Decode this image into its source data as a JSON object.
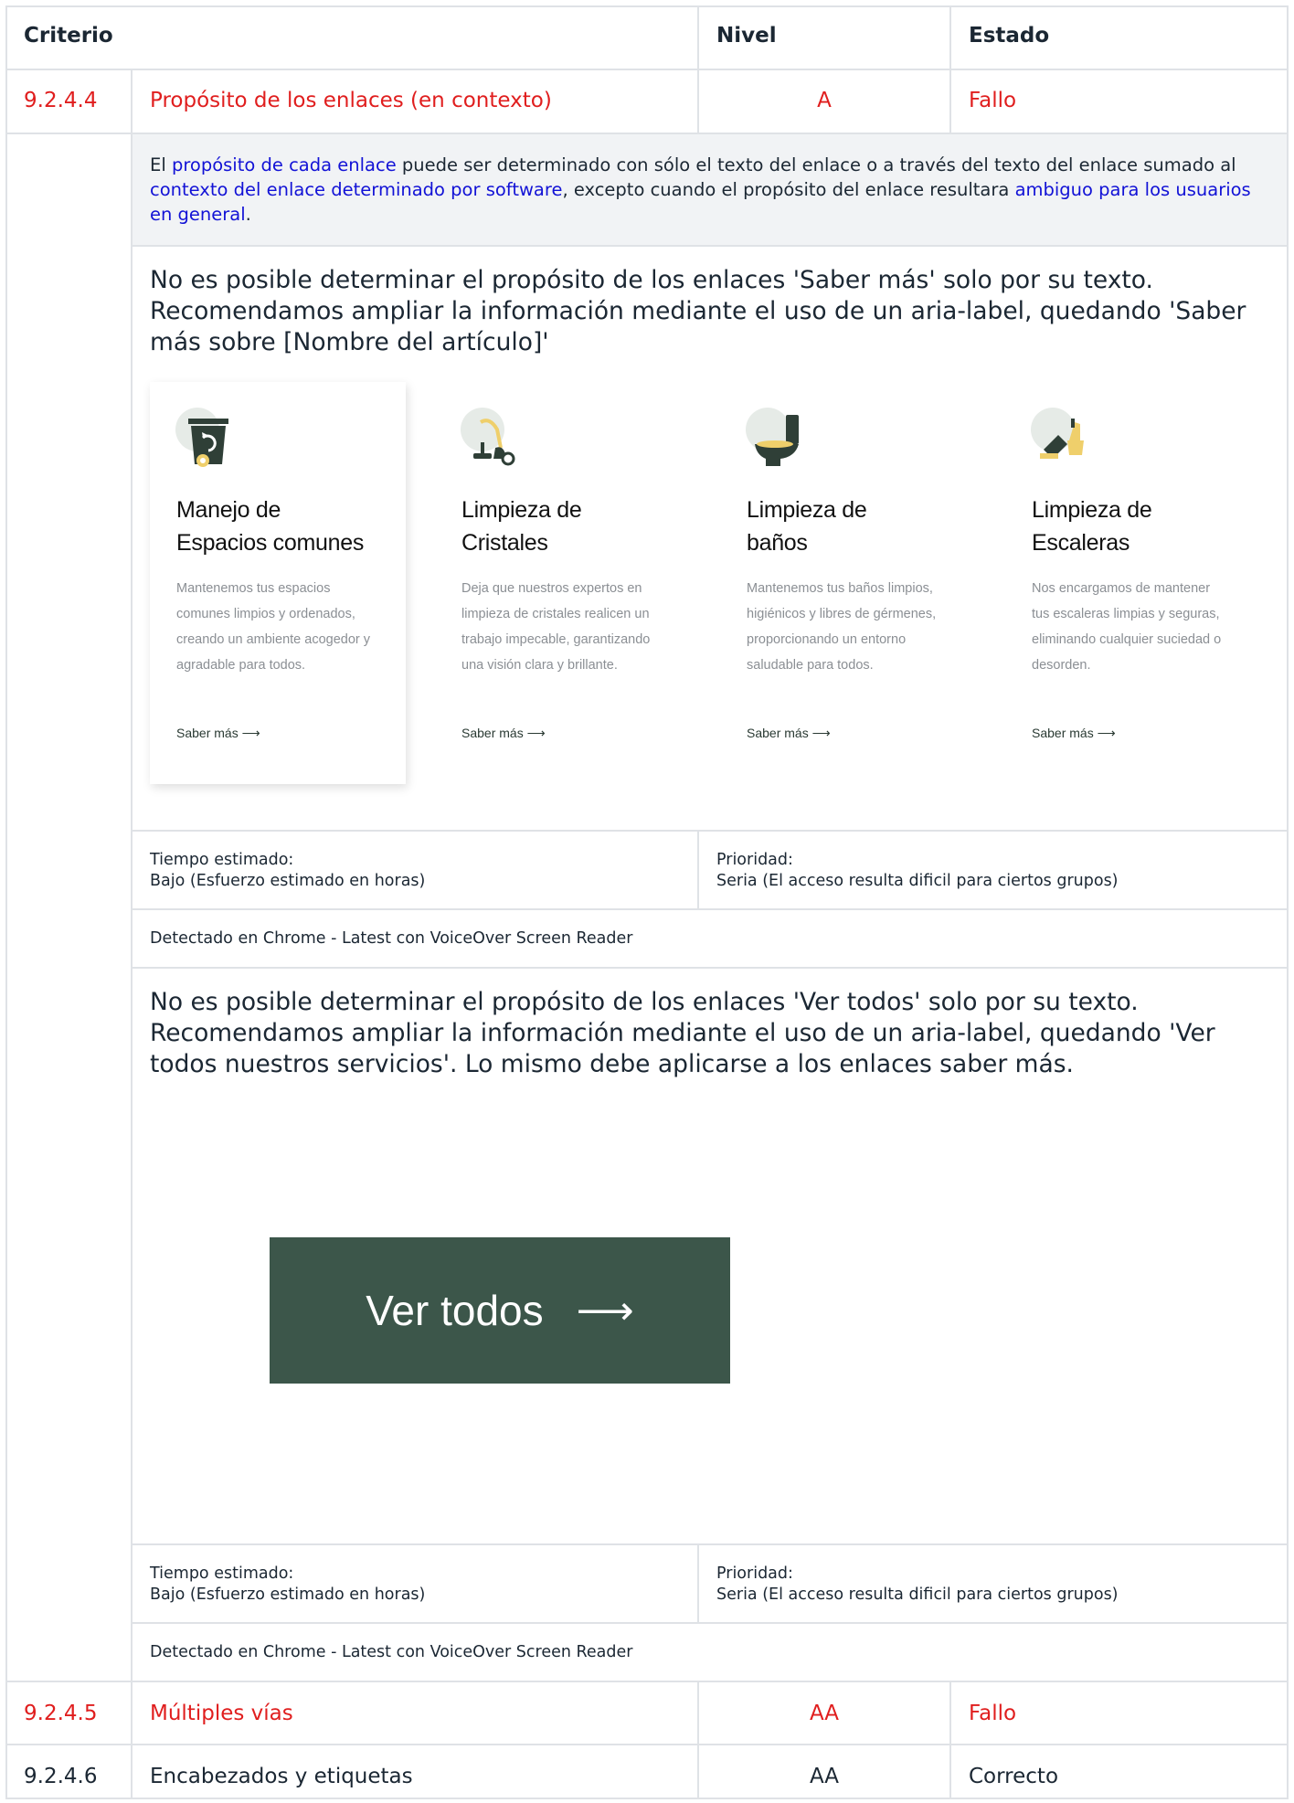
{
  "header": {
    "criterio": "Criterio",
    "nivel": "Nivel",
    "estado": "Estado"
  },
  "row_924_4": {
    "code": "9.2.4.4",
    "name": "Propósito de los enlaces (en contexto)",
    "level": "A",
    "status": "Fallo",
    "description": {
      "p1": "El ",
      "l1": "propósito de cada enlace",
      "p2": " puede ser determinado con sólo el texto del enlace o a través del texto del enlace sumado al ",
      "l2": "contexto del enlace determinado por software",
      "p3": ", excepto cuando el propósito del enlace resultara ",
      "l3": "ambiguo para los usuarios en general",
      "p4": "."
    },
    "issue1": {
      "note": "No es posible determinar el propósito de los enlaces 'Saber más' solo por su texto. Recomendamos ampliar la información mediante el uso de un aria-label, quedando 'Saber más sobre [Nombre del artículo]'",
      "cards": [
        {
          "title1": "Manejo de",
          "title2": "Espacios comunes",
          "text": "Mantenemos tus espacios comunes limpios y ordenados, creando un ambiente acogedor y agradable para todos.",
          "link": "Saber más",
          "icon": "recycle-bin-icon"
        },
        {
          "title1": "Limpieza de",
          "title2": "Cristales",
          "text": "Deja que nuestros expertos en limpieza de cristales realicen un trabajo impecable, garantizando una visión clara y brillante.",
          "link": "Saber más",
          "icon": "vacuum-icon"
        },
        {
          "title1": "Limpieza de",
          "title2": "baños",
          "text": "Mantenemos tus baños limpios, higiénicos y libres de gérmenes, proporcionando un entorno saludable para todos.",
          "link": "Saber más",
          "icon": "toilet-icon"
        },
        {
          "title1": "Limpieza de",
          "title2": "Escaleras",
          "text": "Nos encargamos de mantener tus escaleras limpias y seguras, eliminando cualquier suciedad o desorden.",
          "link": "Saber más",
          "icon": "broom-icon"
        }
      ],
      "time_label": "Tiempo estimado:",
      "time_value": "Bajo (Esfuerzo estimado en horas)",
      "priority_label": "Prioridad:",
      "priority_value": "Seria (El acceso resulta dificil para ciertos grupos)",
      "detected": "Detectado en Chrome - Latest con VoiceOver Screen Reader"
    },
    "issue2": {
      "note": "No es posible determinar el propósito de los enlaces 'Ver todos' solo por su texto. Recomendamos ampliar la información mediante el uso de un aria-label, quedando 'Ver todos nuestros servicios'. Lo mismo debe aplicarse a los enlaces saber más.",
      "button": "Ver todos",
      "time_label": "Tiempo estimado:",
      "time_value": "Bajo (Esfuerzo estimado en horas)",
      "priority_label": "Prioridad:",
      "priority_value": "Seria (El acceso resulta dificil para ciertos grupos)",
      "detected": "Detectado en Chrome - Latest con VoiceOver Screen Reader"
    }
  },
  "row_924_5": {
    "code": "9.2.4.5",
    "name": "Múltiples vías",
    "level": "AA",
    "status": "Fallo"
  },
  "row_924_6": {
    "code": "9.2.4.6",
    "name": "Encabezados y etiquetas",
    "level": "AA",
    "status": "Correcto"
  },
  "colors": {
    "fail": "#e01e1e",
    "link": "#1212d6",
    "button": "#3c564a",
    "border": "#dfe2e6"
  }
}
